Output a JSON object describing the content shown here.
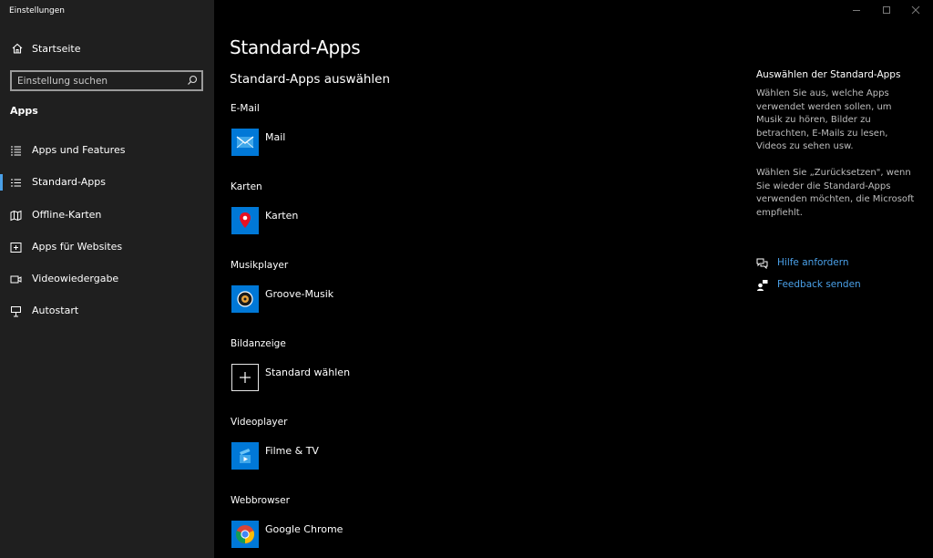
{
  "window": {
    "title": "Einstellungen"
  },
  "sidebar": {
    "home_label": "Startseite",
    "search_placeholder": "Einstellung suchen",
    "section_title": "Apps",
    "items": [
      {
        "label": "Apps und Features",
        "icon": "list-icon"
      },
      {
        "label": "Standard-Apps",
        "icon": "default-apps-icon",
        "active": true
      },
      {
        "label": "Offline-Karten",
        "icon": "map-icon"
      },
      {
        "label": "Apps für Websites",
        "icon": "website-icon"
      },
      {
        "label": "Videowiedergabe",
        "icon": "video-icon"
      },
      {
        "label": "Autostart",
        "icon": "startup-icon"
      }
    ]
  },
  "main": {
    "title": "Standard-Apps",
    "subtitle": "Standard-Apps auswählen",
    "categories": [
      {
        "label": "E-Mail",
        "app": "Mail",
        "icon": "mail-icon"
      },
      {
        "label": "Karten",
        "app": "Karten",
        "icon": "maps-pin-icon"
      },
      {
        "label": "Musikplayer",
        "app": "Groove-Musik",
        "icon": "groove-music-icon"
      },
      {
        "label": "Bildanzeige",
        "app": "Standard wählen",
        "icon": "plus-icon"
      },
      {
        "label": "Videoplayer",
        "app": "Filme & TV",
        "icon": "movies-tv-icon"
      },
      {
        "label": "Webbrowser",
        "app": "Google Chrome",
        "icon": "chrome-icon"
      }
    ]
  },
  "right_panel": {
    "title": "Auswählen der Standard-Apps",
    "paragraph1": "Wählen Sie aus, welche Apps verwendet werden sollen, um Musik zu hören, Bilder zu betrachten, E-Mails zu lesen, Videos zu sehen usw.",
    "paragraph2": "Wählen Sie „Zurücksetzen\", wenn Sie wieder die Standard-Apps verwenden möchten, die Microsoft empfiehlt.",
    "help_link": "Hilfe anfordern",
    "feedback_link": "Feedback senden"
  },
  "colors": {
    "accent": "#0078d7",
    "link": "#4aa0e8",
    "sidebar_bg": "#1f1f1f"
  }
}
